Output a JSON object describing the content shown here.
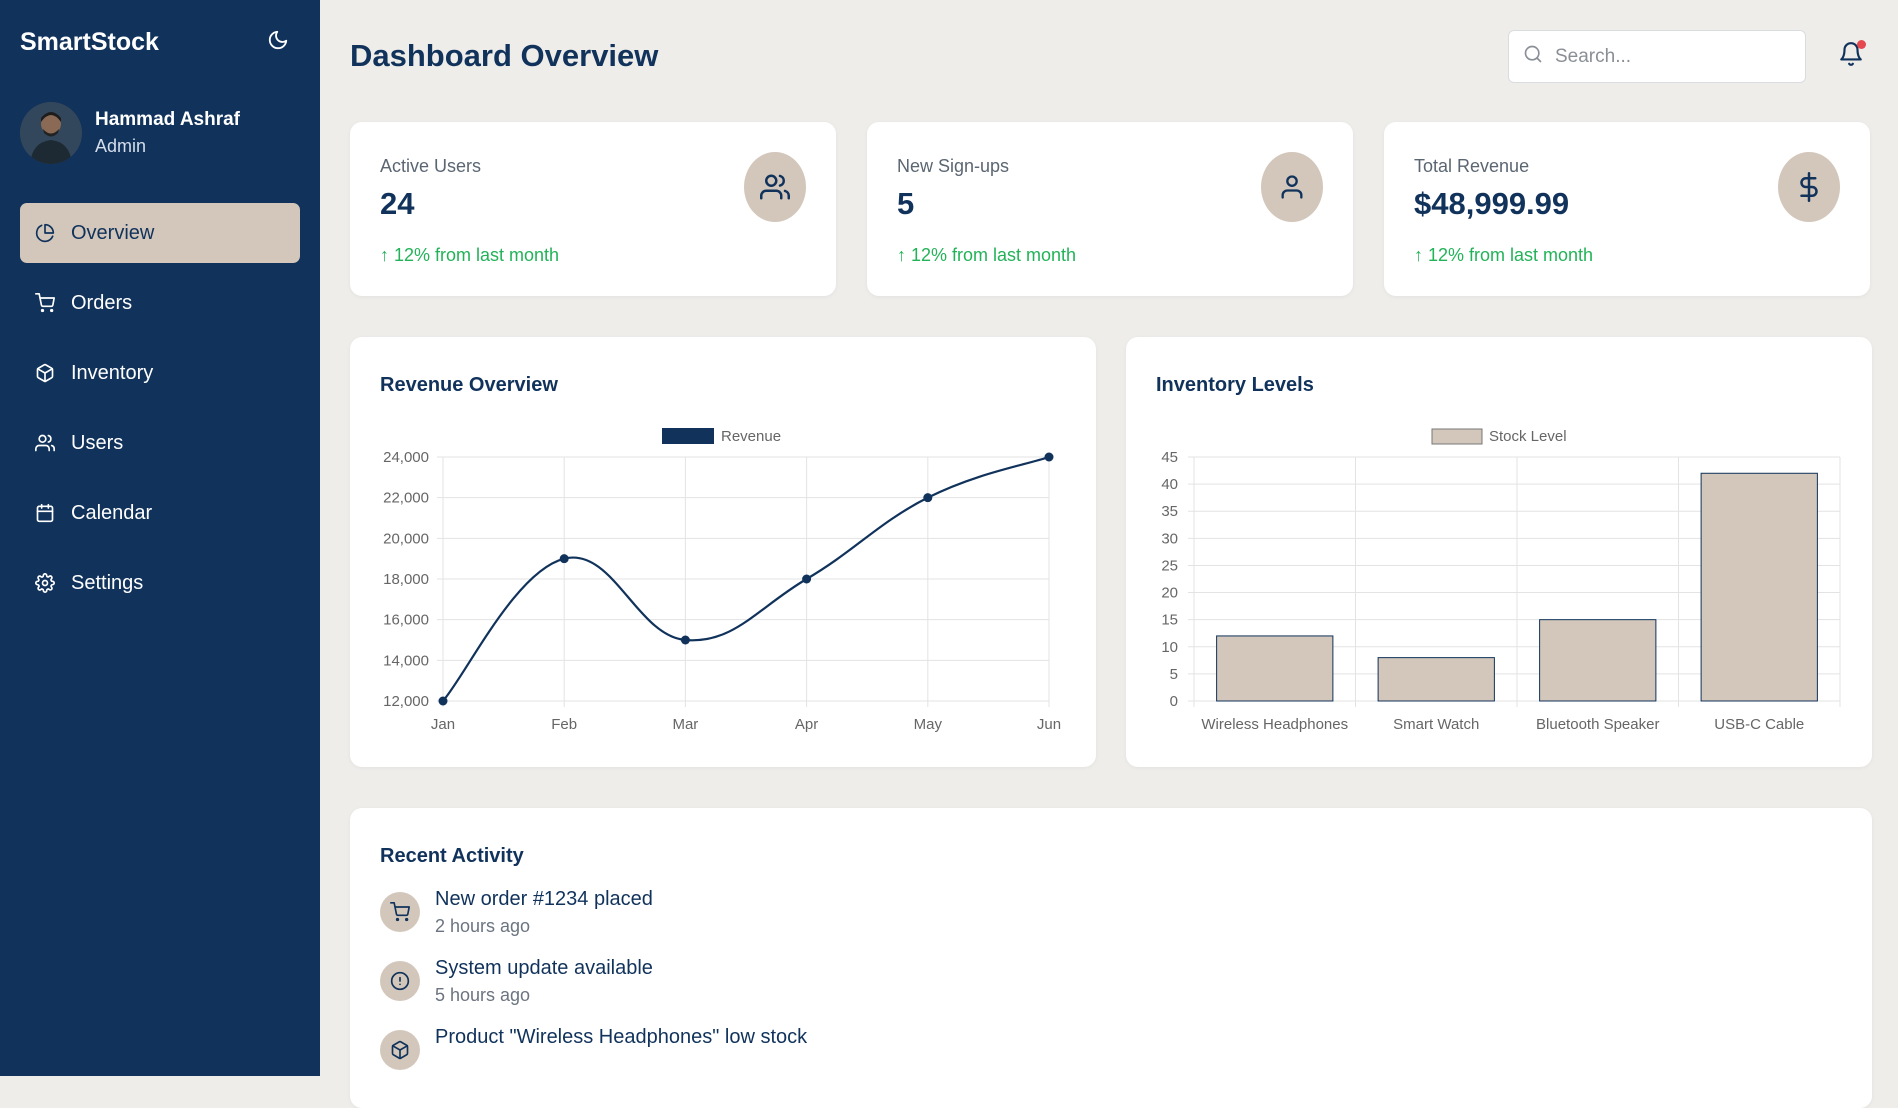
{
  "app": {
    "name": "SmartStock"
  },
  "user": {
    "name": "Hammad Ashraf",
    "role": "Admin"
  },
  "nav": [
    {
      "label": "Overview",
      "icon": "pie-chart-icon",
      "active": true
    },
    {
      "label": "Orders",
      "icon": "cart-icon",
      "active": false
    },
    {
      "label": "Inventory",
      "icon": "box-icon",
      "active": false
    },
    {
      "label": "Users",
      "icon": "users-icon",
      "active": false
    },
    {
      "label": "Calendar",
      "icon": "calendar-icon",
      "active": false
    },
    {
      "label": "Settings",
      "icon": "gear-icon",
      "active": false
    }
  ],
  "header": {
    "title": "Dashboard Overview",
    "search_placeholder": "Search..."
  },
  "stats": [
    {
      "label": "Active Users",
      "value": "24",
      "trend": "↑ 12% from last month",
      "icon": "users-icon"
    },
    {
      "label": "New Sign-ups",
      "value": "5",
      "trend": "↑ 12% from last month",
      "icon": "user-icon"
    },
    {
      "label": "Total Revenue",
      "value": "$48,999.99",
      "trend": "↑ 12% from last month",
      "icon": "dollar-icon"
    }
  ],
  "revenue_card": {
    "title": "Revenue Overview"
  },
  "inventory_card": {
    "title": "Inventory Levels"
  },
  "activity": {
    "title": "Recent Activity",
    "items": [
      {
        "title": "New order #1234 placed",
        "time": "2 hours ago",
        "icon": "cart-icon"
      },
      {
        "title": "System update available",
        "time": "5 hours ago",
        "icon": "alert-icon"
      },
      {
        "title": "Product \"Wireless Headphones\" low stock",
        "time": "",
        "icon": "box-icon"
      }
    ]
  },
  "colors": {
    "navy": "#10325b",
    "beige": "#d3c7bb",
    "green": "#22b358",
    "background": "#efedea"
  },
  "chart_data": [
    {
      "type": "line",
      "title": "Revenue Overview",
      "legend": "top-center",
      "x": [
        "Jan",
        "Feb",
        "Mar",
        "Apr",
        "May",
        "Jun"
      ],
      "series": [
        {
          "name": "Revenue",
          "values": [
            12000,
            19000,
            15000,
            18000,
            22000,
            24000
          ]
        }
      ],
      "ylim": [
        12000,
        24000
      ],
      "yticks": [
        "24,000",
        "22,000",
        "20,000",
        "18,000",
        "16,000",
        "14,000",
        "12,000"
      ],
      "grid": true
    },
    {
      "type": "bar",
      "title": "Inventory Levels",
      "legend": "top-center",
      "categories": [
        "Wireless Headphones",
        "Smart Watch",
        "Bluetooth Speaker",
        "USB-C Cable"
      ],
      "series": [
        {
          "name": "Stock Level",
          "values": [
            12,
            8,
            15,
            42
          ]
        }
      ],
      "ylim": [
        0,
        45
      ],
      "yticks": [
        "45",
        "40",
        "35",
        "30",
        "25",
        "20",
        "15",
        "10",
        "5",
        "0"
      ],
      "grid": true
    }
  ]
}
